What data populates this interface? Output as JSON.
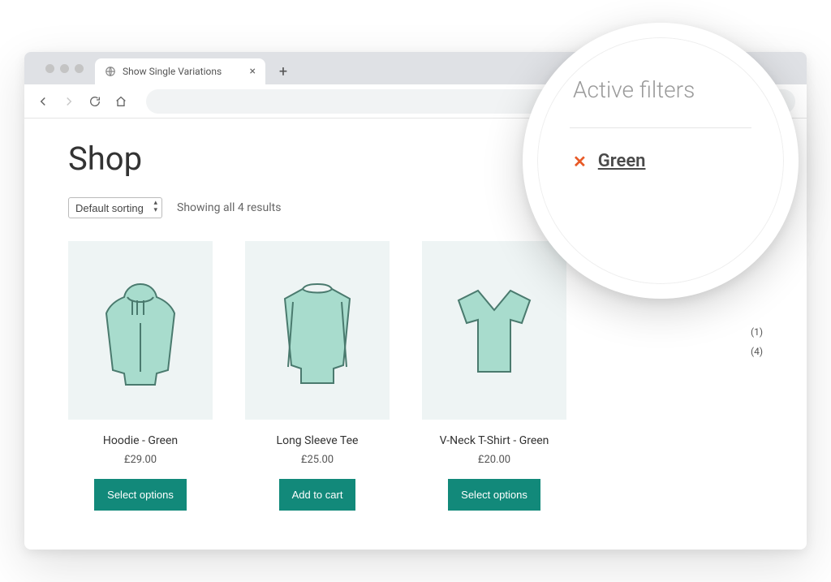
{
  "browser": {
    "tab_title": "Show Single Variations",
    "new_tab_glyph": "+",
    "close_glyph": "×"
  },
  "page": {
    "title": "Shop",
    "sort_selected": "Default sorting",
    "result_text": "Showing all 4 results"
  },
  "products": [
    {
      "name": "Hoodie - Green",
      "price": "£29.00",
      "button": "Select options"
    },
    {
      "name": "Long Sleeve Tee",
      "price": "£25.00",
      "button": "Add to cart"
    },
    {
      "name": "V-Neck T-Shirt - Green",
      "price": "£20.00",
      "button": "Select options"
    }
  ],
  "sidebar_counts": [
    {
      "count": "(1)"
    },
    {
      "count": "(4)"
    }
  ],
  "active_filters": {
    "heading": "Active filters",
    "tag": "Green",
    "remove_glyph": "✕"
  }
}
